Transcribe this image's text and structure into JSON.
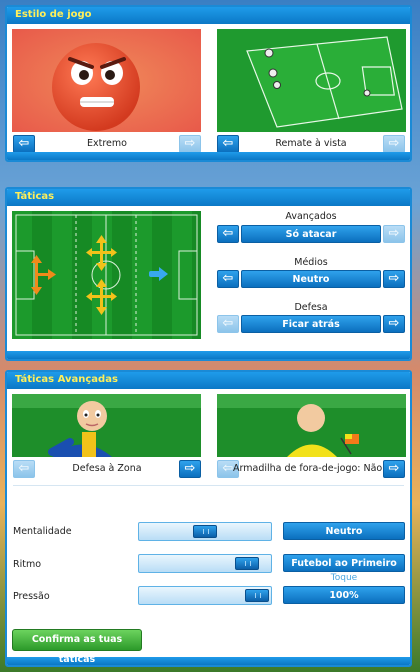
{
  "estilo": {
    "title": "Estilo de jogo",
    "left_caption": "Extremo",
    "right_caption": "Remate à vista"
  },
  "taticas": {
    "title": "Táticas",
    "groups": [
      {
        "label": "Avançados",
        "value": "Só atacar"
      },
      {
        "label": "Médios",
        "value": "Neutro"
      },
      {
        "label": "Defesa",
        "value": "Ficar atrás"
      }
    ]
  },
  "avancadas": {
    "title": "Táticas Avançadas",
    "left_caption": "Defesa à Zona",
    "right_caption": "Armadilha de fora-de-jogo: Não",
    "rows": [
      {
        "label": "Mentalidade",
        "value": "Neutro",
        "level": 0.5
      },
      {
        "label": "Ritmo",
        "value": "Futebol ao Primeiro",
        "sublabel": "Toque",
        "level": 0.9
      },
      {
        "label": "Pressão",
        "value": "100%",
        "level": 1.0
      }
    ],
    "confirm_label": "Confirma as tuas táticas"
  },
  "icons": {
    "prev": "arrow-left-icon",
    "next": "arrow-right-icon"
  },
  "colors": {
    "panel_border": "#1a8ad6",
    "header_text": "#ffef5a",
    "button_blue": "#0b78c6",
    "confirm_green": "#3aa836"
  }
}
